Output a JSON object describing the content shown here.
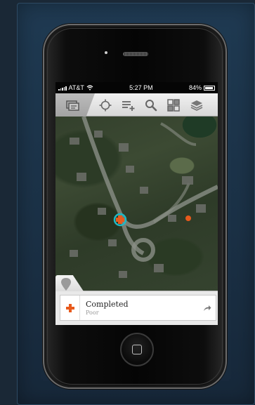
{
  "status_bar": {
    "carrier": "AT&T",
    "time": "5:27 PM",
    "battery": "84%"
  },
  "toolbar": {
    "icons": [
      "layers-panel-icon",
      "locate-icon",
      "add-record-icon",
      "search-icon",
      "grid-view-icon",
      "layers-icon"
    ]
  },
  "map": {
    "markers": [
      {
        "name": "selected-feature-marker",
        "color": "#e85a1c"
      },
      {
        "name": "feature-point",
        "color": "#e85a1c"
      }
    ]
  },
  "result": {
    "title": "Completed",
    "subtitle": "Poor"
  },
  "colors": {
    "accent": "#e85a1c",
    "highlight": "#1fb8c4",
    "panel_background": "#1f3a52"
  }
}
